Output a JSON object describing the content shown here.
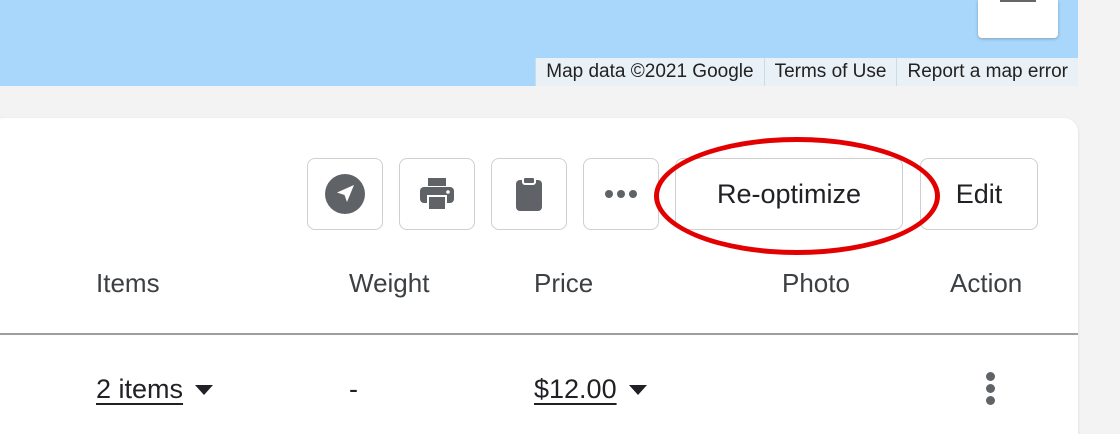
{
  "map": {
    "attribution": "Map data ©2021 Google",
    "terms": "Terms of Use",
    "report": "Report a map error"
  },
  "toolbar": {
    "navigate_icon": "navigation-compass-icon",
    "print_icon": "printer-icon",
    "clipboard_icon": "clipboard-icon",
    "more_icon": "more-horizontal-icon",
    "reoptimize_label": "Re-optimize",
    "edit_label": "Edit"
  },
  "table": {
    "columns": [
      "Items",
      "Weight",
      "Price",
      "Photo",
      "Action"
    ],
    "rows": [
      {
        "items": "2 items",
        "weight": "-",
        "price": "$12.00",
        "photo": "",
        "action_icon": "more-vertical-icon"
      }
    ]
  },
  "colors": {
    "map_water": "#a9d7fb",
    "annotation_red": "#e30000",
    "icon_gray": "#5f6368"
  }
}
